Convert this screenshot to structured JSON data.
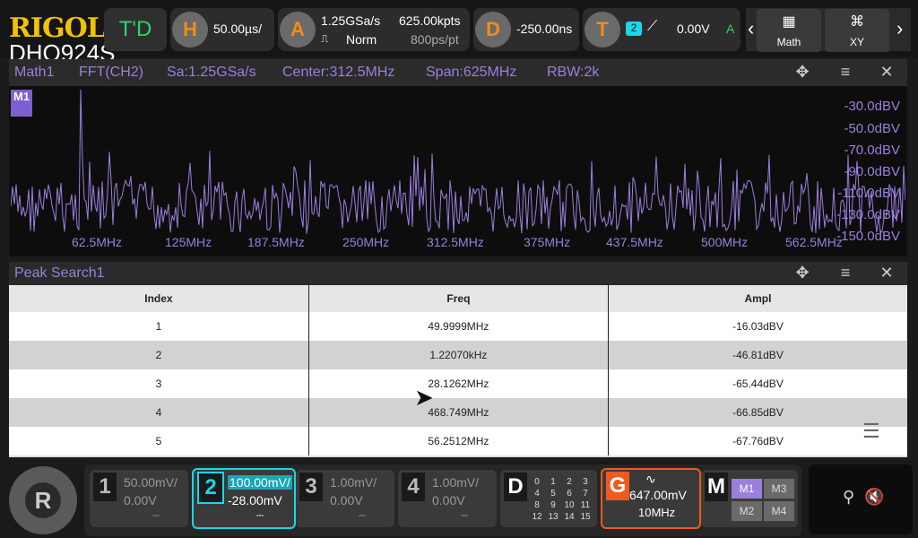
{
  "brand": {
    "logo": "RIGOL",
    "model": "DHO924S"
  },
  "topbar": {
    "td_label": "T'D",
    "horizontal": {
      "letter": "H",
      "value": "50.00µs/"
    },
    "acquire": {
      "letter": "A",
      "sample_rate": "1.25GSa/s",
      "mode": "Norm",
      "points": "625.00kpts",
      "per_pixel": "800ps/pt"
    },
    "delay": {
      "letter": "D",
      "value": "-250.00ns"
    },
    "trigger": {
      "letter": "T",
      "source": "2",
      "level": "0.00V",
      "status": "A"
    },
    "nav": {
      "math_label": "Math",
      "xy_label": "XY"
    }
  },
  "math_window": {
    "title": "Math1",
    "source": "FFT(CH2)",
    "sa": "Sa:1.25GSa/s",
    "center": "Center:312.5MHz",
    "span": "Span:625MHz",
    "rbw": "RBW:2k",
    "marker": "M1",
    "ticks_y": [
      "-30.0dBV",
      "-50.0dBV",
      "-70.0dBV",
      "-90.0dBV",
      "-110.0dBV",
      "-130.0dBV",
      "-150.0dBV"
    ],
    "ticks_x": [
      "62.5MHz",
      "125MHz",
      "187.5MHz",
      "250MHz",
      "312.5MHz",
      "375MHz",
      "437.5MHz",
      "500MHz",
      "562.5MHz"
    ]
  },
  "peak_window": {
    "title": "Peak Search1",
    "columns": [
      "Index",
      "Freq",
      "Ampl"
    ],
    "rows": [
      [
        "1",
        "49.9999MHz",
        "-16.03dBV"
      ],
      [
        "2",
        "1.22070kHz",
        "-46.81dBV"
      ],
      [
        "3",
        "28.1262MHz",
        "-65.44dBV"
      ],
      [
        "4",
        "468.749MHz",
        "-66.85dBV"
      ],
      [
        "5",
        "56.2512MHz",
        "-67.76dBV"
      ]
    ]
  },
  "channels": [
    {
      "num": "1",
      "scale": "50.00mV/",
      "offset": "0.00V",
      "color": "#8a8a8a"
    },
    {
      "num": "2",
      "scale": "100.00mV/",
      "offset": "-28.00mV",
      "color": "#19d7e8"
    },
    {
      "num": "3",
      "scale": "1.00mV/",
      "offset": "0.00V",
      "color": "#8a8a8a"
    },
    {
      "num": "4",
      "scale": "1.00mV/",
      "offset": "0.00V",
      "color": "#8a8a8a"
    }
  ],
  "digital": {
    "letter": "D",
    "grid": [
      "0",
      "1",
      "2",
      "3",
      "4",
      "5",
      "6",
      "7",
      "8",
      "9",
      "10",
      "11",
      "12",
      "13",
      "14",
      "15"
    ]
  },
  "generator": {
    "letter": "G",
    "amplitude": "647.00mV",
    "freq": "10MHz",
    "color": "#f05a1e"
  },
  "math_menu": {
    "letter": "M",
    "items": [
      "M1",
      "M3",
      "M2",
      "M4"
    ]
  },
  "fft_accent": "#9b7fdc"
}
